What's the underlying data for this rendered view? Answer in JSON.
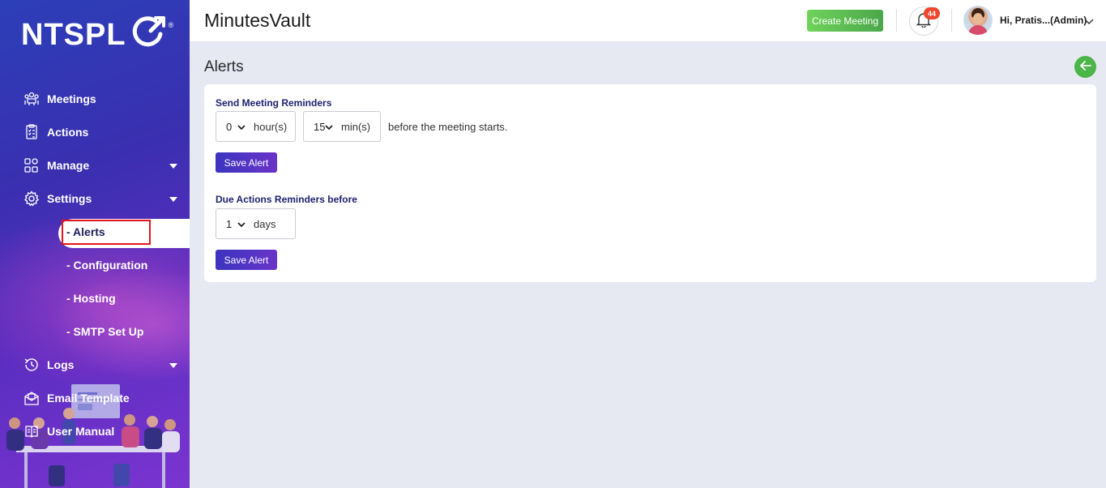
{
  "brand": {
    "logo_text": "NTSPL",
    "registered_mark": "®"
  },
  "sidebar": {
    "items": [
      {
        "label": "Meetings",
        "icon": "meetings-icon"
      },
      {
        "label": "Actions",
        "icon": "actions-icon"
      },
      {
        "label": "Manage",
        "icon": "manage-icon",
        "expandable": true
      },
      {
        "label": "Settings",
        "icon": "settings-icon",
        "expandable": true
      },
      {
        "label": "Logs",
        "icon": "logs-icon",
        "expandable": true
      },
      {
        "label": "Email Template",
        "icon": "email-template-icon"
      },
      {
        "label": "User Manual",
        "icon": "user-manual-icon"
      }
    ],
    "settings_sub": [
      "- Alerts",
      "- Configuration",
      "- Hosting",
      "- SMTP Set Up"
    ],
    "active_sub": "- Alerts"
  },
  "header": {
    "app_title": "MinutesVault",
    "create_meeting_label": "Create Meeting",
    "notification_count": "44",
    "user_greeting": "Hi, Pratis...(Admin)"
  },
  "main": {
    "page_title": "Alerts",
    "meeting_reminders": {
      "title": "Send Meeting Reminders",
      "hours_value": "0",
      "hours_unit": "hour(s)",
      "mins_value": "15",
      "mins_unit": "min(s)",
      "suffix_text": "before the meeting starts.",
      "save_label": "Save Alert"
    },
    "due_actions": {
      "title": "Due Actions Reminders before",
      "days_value": "1",
      "days_unit": "days",
      "save_label": "Save Alert"
    }
  },
  "colors": {
    "sidebar_gradient_start": "#2c3fb8",
    "sidebar_gradient_end": "#7b34d0",
    "create_button": "#5cbf50",
    "save_button": "#4a34c4",
    "back_button": "#4bb548",
    "badge": "#f0462e",
    "highlight_box": "#e5141c"
  }
}
